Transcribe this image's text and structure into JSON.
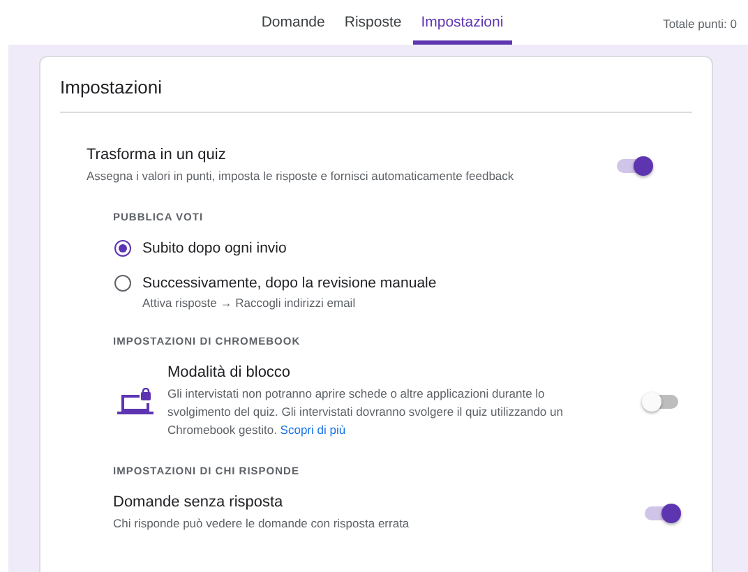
{
  "tabs": [
    {
      "label": "Domande",
      "selected": false
    },
    {
      "label": "Risposte",
      "selected": false
    },
    {
      "label": "Impostazioni",
      "selected": true
    }
  ],
  "total_points": "Totale punti: 0",
  "panel": {
    "title": "Impostazioni",
    "quiz": {
      "title": "Trasforma in un quiz",
      "description": "Assegna i valori in punti, imposta le risposte e fornisci automaticamente feedback",
      "on": true
    },
    "sections": [
      {
        "heading": "PUBBLICA VOTI",
        "items": [
          {
            "kind": "radio",
            "label": "Subito dopo ogni invio",
            "selected": true
          },
          {
            "kind": "radio",
            "label": "Successivamente, dopo la revisione manuale",
            "hint": "Attiva risposte → Raccogli indirizzi email",
            "selected": false
          }
        ]
      },
      {
        "heading": "IMPOSTAZIONI DI CHROMEBOOK",
        "items": [
          {
            "kind": "device_toggle",
            "title": "Modalità di blocco",
            "description": "Gli intervistati non potranno aprire schede o altre applicazioni durante lo svolgimento del quiz. Gli intervistati dovranno svolgere il quiz utilizzando un Chromebook gestito.",
            "link": "Scopri di più",
            "on": false
          }
        ]
      },
      {
        "heading": "IMPOSTAZIONI DI CHI RISPONDE",
        "items": [
          {
            "kind": "toggle",
            "title": "Domande senza risposta",
            "description": "Chi risponde può vedere le domande con risposta errata",
            "on": true
          }
        ]
      }
    ]
  }
}
